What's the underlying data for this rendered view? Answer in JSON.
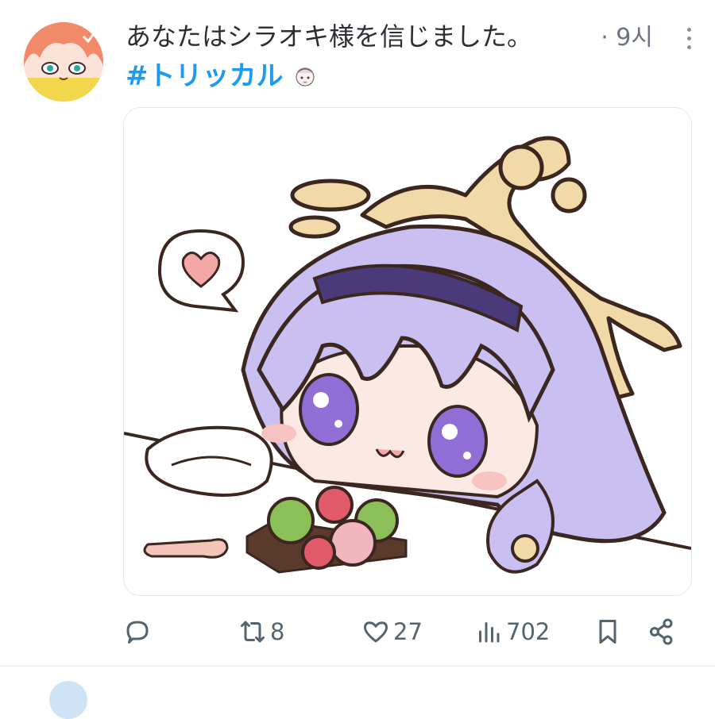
{
  "tweet": {
    "text": "あなたはシラオキ様を信じました。",
    "time": "· 9시",
    "hashtag": "#トリッカル",
    "avatar_icon": "user-avatar-anime-girl",
    "media_description_icon": "anime-girl-illustration",
    "actions": {
      "reply_count": "",
      "retweet_count": "8",
      "like_count": "27",
      "views_count": "702"
    }
  },
  "colors": {
    "accent": "#1d9bf0",
    "muted": "#536471",
    "hair": "#c9bff0"
  }
}
